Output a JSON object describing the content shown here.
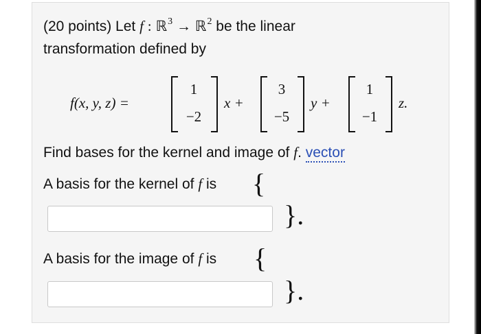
{
  "problem": {
    "intro_prefix": "(20 points) Let",
    "f": "f",
    "colon": ":",
    "domain": "ℝ",
    "domain_exp": "3",
    "arrow": "→",
    "codomain": "ℝ",
    "codomain_exp": "2",
    "intro_suffix": "be the linear",
    "line2": "transformation defined by"
  },
  "equation": {
    "lhs": "f(x, y, z) =",
    "vec1": [
      "1",
      "−2"
    ],
    "var1": "x +",
    "vec2": [
      "3",
      "−5"
    ],
    "var2": "y +",
    "vec3": [
      "1",
      "−1"
    ],
    "var3": "z."
  },
  "prompt": {
    "text_prefix": "Find bases for the kernel and image of",
    "f": "f",
    "period": ".",
    "link": "vector"
  },
  "kernel": {
    "label_prefix": "A basis for the kernel of",
    "f": "f",
    "label_suffix": "is",
    "open_brace": "{",
    "close_brace": "}.",
    "input_value": ""
  },
  "image": {
    "label_prefix": "A basis for the image of",
    "f": "f",
    "label_suffix": "is",
    "open_brace": "{",
    "close_brace": "}.",
    "input_value": ""
  }
}
